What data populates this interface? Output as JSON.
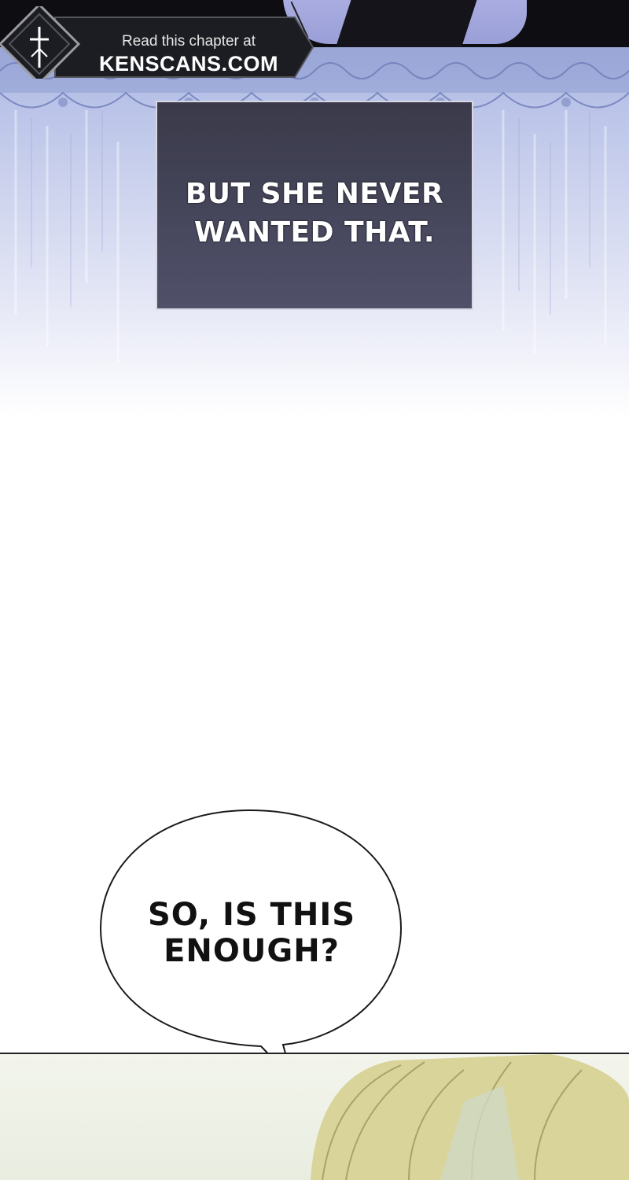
{
  "watermark": {
    "line1": "Read this chapter at",
    "line2": "KENSCANS.COM",
    "logo_icon": "sword-emblem-icon"
  },
  "narration": {
    "text": "BUT SHE NEVER WANTED THAT."
  },
  "speech_bubble": {
    "text": "SO, IS THIS ENOUGH?"
  },
  "colors": {
    "narration_box": "#45455a",
    "sky_top": "#a9b5e0",
    "banner_bg": "#1c1d22",
    "hair": "#d9d49a"
  }
}
